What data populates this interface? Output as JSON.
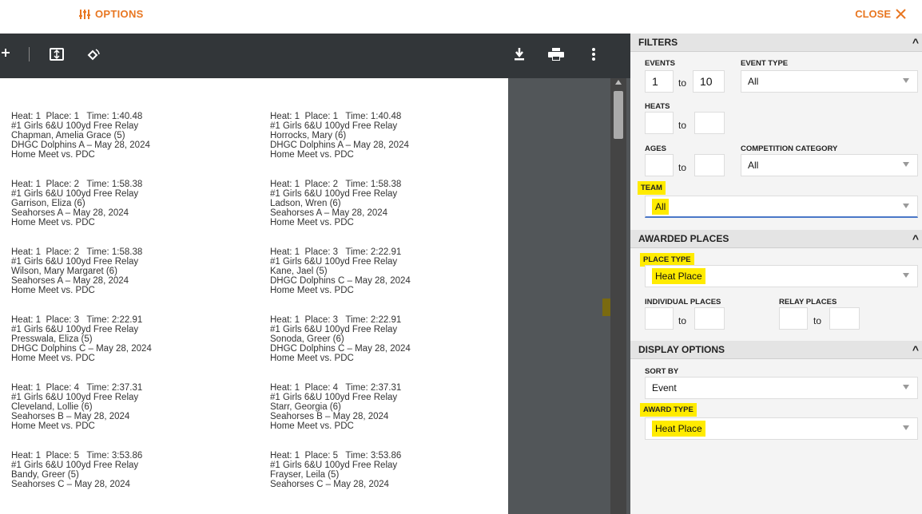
{
  "header": {
    "options_label": "OPTIONS",
    "close_label": "CLOSE"
  },
  "viewer": {
    "records": [
      [
        "Heat: 1  Place: 1   Time: 1:40.48",
        "#1 Girls 6&U 100yd Free Relay",
        "Chapman, Amelia Grace (5)",
        "DHGC Dolphins A – May 28, 2024",
        "Home Meet vs. PDC"
      ],
      [
        "Heat: 1  Place: 1   Time: 1:40.48",
        "#1 Girls 6&U 100yd Free Relay",
        "Horrocks, Mary (6)",
        "DHGC Dolphins A – May 28, 2024",
        "Home Meet vs. PDC"
      ],
      [
        "Heat: 1  Place: 2   Time: 1:58.38",
        "#1 Girls 6&U 100yd Free Relay",
        "Garrison, Eliza (6)",
        "Seahorses A – May 28, 2024",
        "Home Meet vs. PDC"
      ],
      [
        "Heat: 1  Place: 2   Time: 1:58.38",
        "#1 Girls 6&U 100yd Free Relay",
        "Ladson, Wren (6)",
        "Seahorses A – May 28, 2024",
        "Home Meet vs. PDC"
      ],
      [
        "Heat: 1  Place: 2   Time: 1:58.38",
        "#1 Girls 6&U 100yd Free Relay",
        "Wilson, Mary Margaret (6)",
        "Seahorses A – May 28, 2024",
        "Home Meet vs. PDC"
      ],
      [
        "Heat: 1  Place: 3   Time: 2:22.91",
        "#1 Girls 6&U 100yd Free Relay",
        "Kane, Jael (5)",
        "DHGC Dolphins C – May 28, 2024",
        "Home Meet vs. PDC"
      ],
      [
        "Heat: 1  Place: 3   Time: 2:22.91",
        "#1 Girls 6&U 100yd Free Relay",
        "Presswala, Eliza (5)",
        "DHGC Dolphins C – May 28, 2024",
        "Home Meet vs. PDC"
      ],
      [
        "Heat: 1  Place: 3   Time: 2:22.91",
        "#1 Girls 6&U 100yd Free Relay",
        "Sonoda, Greer (6)",
        "DHGC Dolphins C – May 28, 2024",
        "Home Meet vs. PDC"
      ],
      [
        "Heat: 1  Place: 4   Time: 2:37.31",
        "#1 Girls 6&U 100yd Free Relay",
        "Cleveland, Lollie (6)",
        "Seahorses B – May 28, 2024",
        "Home Meet vs. PDC"
      ],
      [
        "Heat: 1  Place: 4   Time: 2:37.31",
        "#1 Girls 6&U 100yd Free Relay",
        "Starr, Georgia (6)",
        "Seahorses B – May 28, 2024",
        "Home Meet vs. PDC"
      ],
      [
        "Heat: 1  Place: 5   Time: 3:53.86",
        "#1 Girls 6&U 100yd Free Relay",
        "Bandy, Greer (5)",
        "Seahorses C – May 28, 2024"
      ],
      [
        "Heat: 1  Place: 5   Time: 3:53.86",
        "#1 Girls 6&U 100yd Free Relay",
        "Frayser, Leila (5)",
        "Seahorses C – May 28, 2024"
      ]
    ]
  },
  "filters": {
    "title": "FILTERS",
    "events_label": "EVENTS",
    "events_from": "1",
    "events_to": "10",
    "to_label": "to",
    "event_type_label": "EVENT TYPE",
    "event_type_value": "All",
    "heats_label": "HEATS",
    "heats_from": "",
    "heats_to": "",
    "ages_label": "AGES",
    "ages_from": "",
    "ages_to": "",
    "competition_label": "COMPETITION CATEGORY",
    "competition_value": "All",
    "team_label": "TEAM",
    "team_value": "All"
  },
  "awarded": {
    "title": "AWARDED PLACES",
    "place_type_label": "PLACE TYPE",
    "place_type_value": "Heat Place",
    "individual_label": "INDIVIDUAL PLACES",
    "relay_label": "RELAY PLACES",
    "to_label": "to"
  },
  "display": {
    "title": "DISPLAY OPTIONS",
    "sort_label": "SORT BY",
    "sort_value": "Event",
    "award_type_label": "AWARD TYPE",
    "award_type_value": "Heat Place"
  },
  "colors": {
    "accent": "#e87722",
    "highlight": "#ffeb00",
    "toolbar": "#323639"
  }
}
